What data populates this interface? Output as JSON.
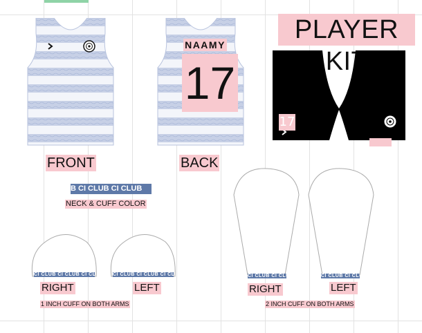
{
  "title": "PLAYER KIT",
  "player": {
    "name": "NAAMY",
    "number": "17"
  },
  "labels": {
    "front": "FRONT",
    "back": "BACK",
    "neck_cuff": "NECK & CUFF COLOR",
    "right_small": "RIGHT",
    "left_small": "LEFT",
    "right_long": "RIGHT",
    "left_long": "LEFT",
    "cuff_note_short": "1 INCH CUFF ON BOTH ARMS",
    "cuff_note_long": "2 INCH CUFF ON BOTH ARMS"
  },
  "band_text": {
    "neck": "B CI  CLUB CI  CLUB",
    "cuff": "CI  CLUB CI  CLUB CI  CLUB"
  },
  "colors": {
    "highlight": "#f8c9cf",
    "band": "#5e79a8",
    "shorts": "#000000",
    "stripe": "#c7d0e6"
  },
  "icons": {
    "chevron": "chevron-right-icon",
    "crest": "club-crest-icon"
  }
}
